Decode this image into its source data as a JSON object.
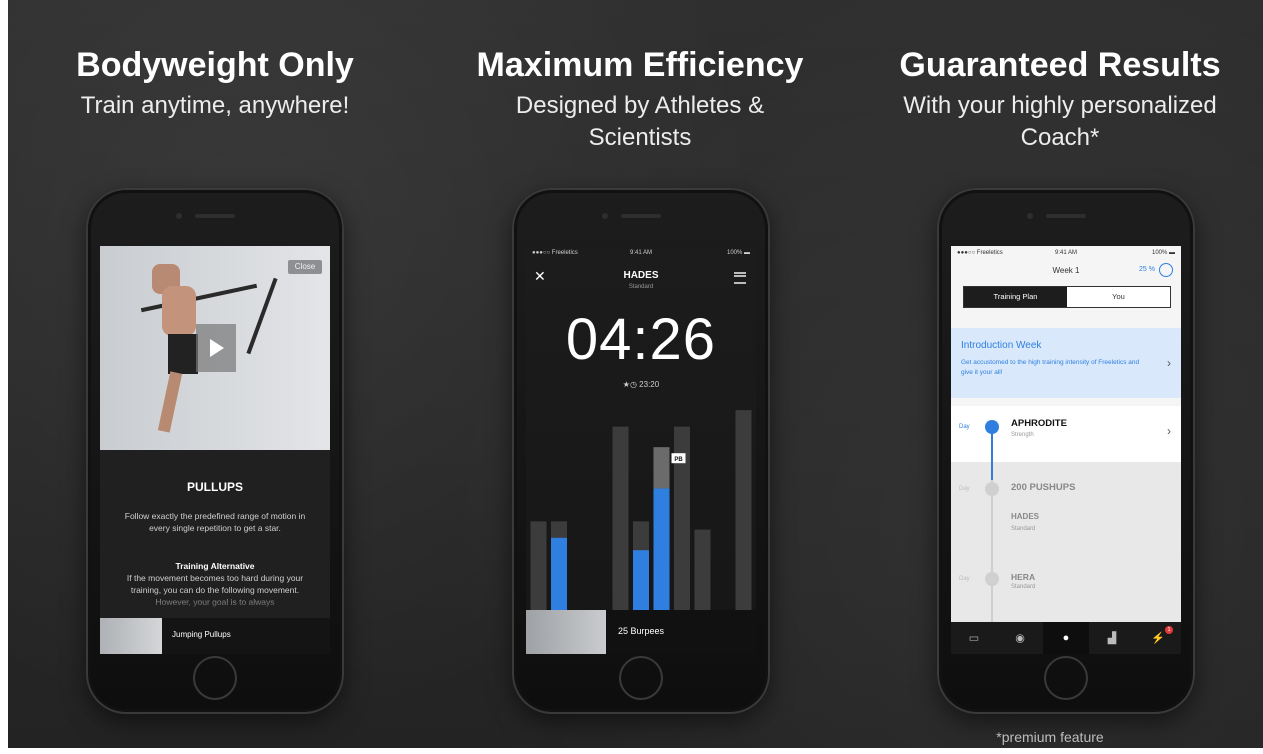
{
  "columns": [
    {
      "title": "Bodyweight Only",
      "subtitle_lines": [
        "Train anytime, anywhere!"
      ]
    },
    {
      "title": "Maximum Efficiency",
      "subtitle_lines": [
        "Designed by Athletes &",
        "Scientists"
      ]
    },
    {
      "title": "Guaranteed Results",
      "subtitle_lines": [
        "With your highly personalized",
        "Coach*"
      ]
    }
  ],
  "phone1": {
    "close_label": "Close",
    "exercise_title": "PULLUPS",
    "description": "Follow exactly the predefined range of motion in every single repetition to get a star.",
    "alt_title": "Training Alternative",
    "alt_text": "If the movement becomes too hard during your training, you can do the following movement. However, your goal is to always",
    "bottom_label": "Jumping Pullups"
  },
  "phone2": {
    "status": {
      "carrier": "●●●○○ Freeletics",
      "time": "9:41 AM",
      "battery": "100% ▬"
    },
    "close_symbol": "✕",
    "workout_name": "HADES",
    "workout_variant": "Standard",
    "timer": "04:26",
    "personal_best": "23:20",
    "pb_label": "PB",
    "bottom_label": "25 Burpees",
    "chart": {
      "bars": [
        {
          "total": 0.44,
          "fill": 0.0
        },
        {
          "total": 0.44,
          "fill": 0.36
        },
        {
          "total": 0.0,
          "fill": 0.0
        },
        {
          "total": 0.0,
          "fill": 0.0
        },
        {
          "total": 0.9,
          "fill": 0.0
        },
        {
          "total": 0.44,
          "fill": 0.3
        },
        {
          "total": 0.8,
          "fill": 0.6
        },
        {
          "total": 0.9,
          "fill": 0.0
        },
        {
          "total": 0.4,
          "fill": 0.0
        },
        {
          "total": 0.0,
          "fill": 0.0
        },
        {
          "total": 0.98,
          "fill": 0.0
        }
      ],
      "colors": {
        "bar": "#3c3c3c",
        "fill": "#2f7fe0",
        "highlight": "#6b6b6b"
      }
    }
  },
  "phone3": {
    "status": {
      "carrier": "●●●○○ Freeletics",
      "time": "9:41 AM",
      "battery": "100% ▬"
    },
    "week_label": "Week 1",
    "progress_label": "25 %",
    "tabs": [
      "Training Plan",
      "You"
    ],
    "intro_title": "Introduction Week",
    "intro_text": "Get accustomed to the high training intensity of Freeletics and give it your all!",
    "day_label": "Day",
    "workouts": [
      {
        "day": "1",
        "name": "APHRODITE",
        "sub": "Strength"
      },
      {
        "day": "2",
        "name": "200 PUSHUPS",
        "sub": ""
      },
      {
        "day": "",
        "name": "HADES",
        "sub": "Standard"
      },
      {
        "day": "3",
        "name": "HERA",
        "sub": "Standard"
      }
    ],
    "badge_count": "1",
    "tab_icons": [
      "chat-icon",
      "medal-icon",
      "coach-icon",
      "podium-icon",
      "bolt-icon"
    ]
  },
  "footnote": "*premium feature",
  "colors": {
    "accent_blue": "#2f7fe0",
    "bg_dark": "#2a2a2a"
  }
}
